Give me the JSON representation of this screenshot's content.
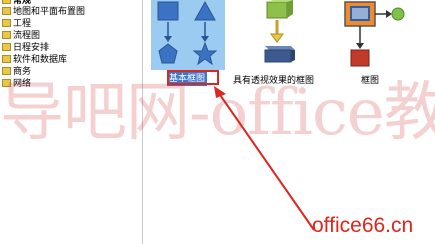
{
  "categories": {
    "top_label": "常规",
    "items": [
      {
        "label": "地图和平面布置图"
      },
      {
        "label": "工程"
      },
      {
        "label": "流程图"
      },
      {
        "label": "日程安排"
      },
      {
        "label": "软件和数据库"
      },
      {
        "label": "商务"
      },
      {
        "label": "网络"
      }
    ]
  },
  "templates": [
    {
      "label": "基本框图",
      "selected": true
    },
    {
      "label": "具有透视效果的框图",
      "selected": false
    },
    {
      "label": "框图",
      "selected": false
    }
  ],
  "watermark": "导吧网-office教程网",
  "site_label": "office66.cn",
  "colors": {
    "selected_bg": "#9ccbf2",
    "caption_bg": "#3d78c8",
    "annotation_red": "#e0251f",
    "folder_yellow": "#e8c84a"
  }
}
